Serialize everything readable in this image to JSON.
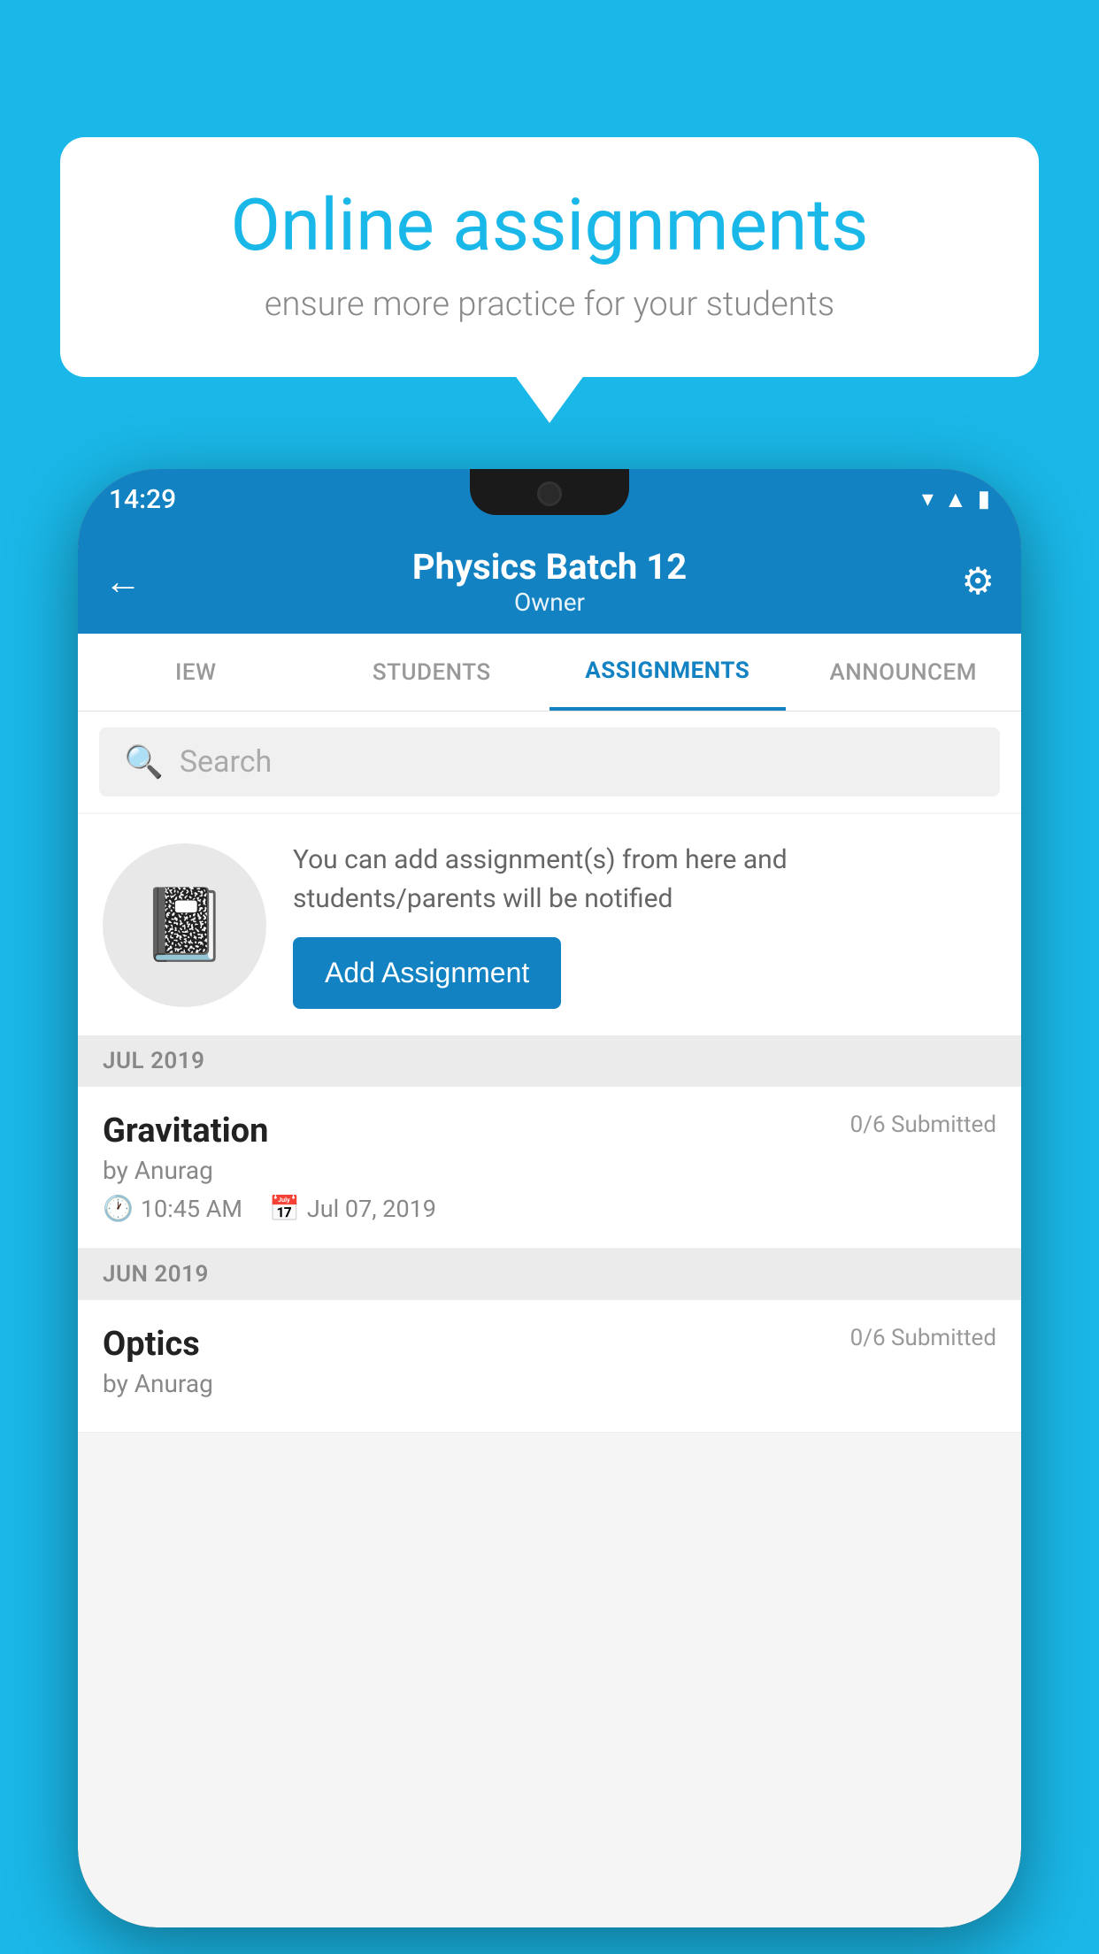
{
  "background": {
    "color": "#1ab8e8"
  },
  "speech_bubble": {
    "title": "Online assignments",
    "subtitle": "ensure more practice for your students"
  },
  "phone": {
    "status_bar": {
      "time": "14:29",
      "icons": [
        "wifi",
        "signal",
        "battery"
      ]
    },
    "header": {
      "title": "Physics Batch 12",
      "subtitle": "Owner",
      "back_label": "←",
      "settings_label": "⚙"
    },
    "tabs": [
      {
        "label": "IEW",
        "active": false
      },
      {
        "label": "STUDENTS",
        "active": false
      },
      {
        "label": "ASSIGNMENTS",
        "active": true
      },
      {
        "label": "ANNOUNCEM",
        "active": false
      }
    ],
    "search": {
      "placeholder": "Search"
    },
    "add_assignment_section": {
      "description": "You can add assignment(s) from here and students/parents will be notified",
      "button_label": "Add Assignment"
    },
    "sections": [
      {
        "month": "JUL 2019",
        "assignments": [
          {
            "name": "Gravitation",
            "submitted": "0/6 Submitted",
            "by": "by Anurag",
            "time": "10:45 AM",
            "date": "Jul 07, 2019"
          }
        ]
      },
      {
        "month": "JUN 2019",
        "assignments": [
          {
            "name": "Optics",
            "submitted": "0/6 Submitted",
            "by": "by Anurag",
            "time": "",
            "date": ""
          }
        ]
      }
    ]
  }
}
